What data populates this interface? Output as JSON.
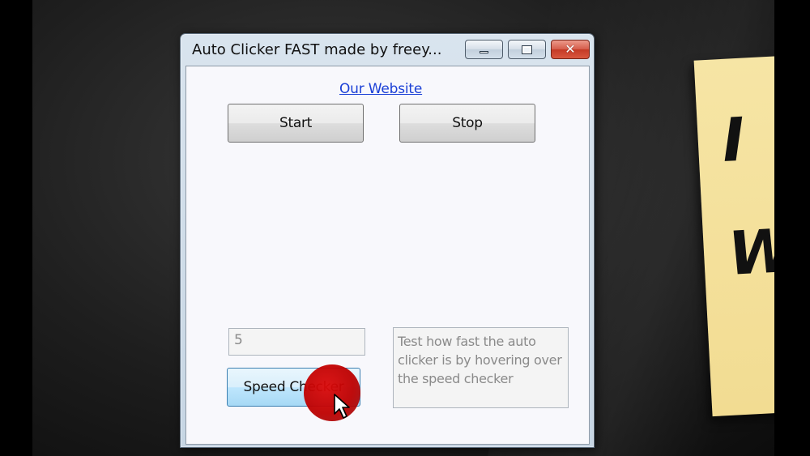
{
  "window": {
    "title": "Auto Clicker FAST made by freey..."
  },
  "title_bar": {
    "minimize_icon": "minimize-icon",
    "maximize_icon": "maximize-icon",
    "close_icon": "close-icon",
    "close_glyph": "✕"
  },
  "main": {
    "website_link": "Our Website",
    "start_label": "Start",
    "stop_label": "Stop",
    "speed_value": "5",
    "speed_checker_label": "Speed Checker",
    "info_text": "Test how fast the auto clicker is by hovering over the speed checker"
  },
  "background": {
    "sticky_note_line_1": "I N",
    "sticky_note_line_2": "Wa"
  },
  "colors": {
    "link": "#1a3fd6",
    "close_button": "#c43a26",
    "click_indicator": "#c80000",
    "sticky_note": "#f4e09c"
  }
}
